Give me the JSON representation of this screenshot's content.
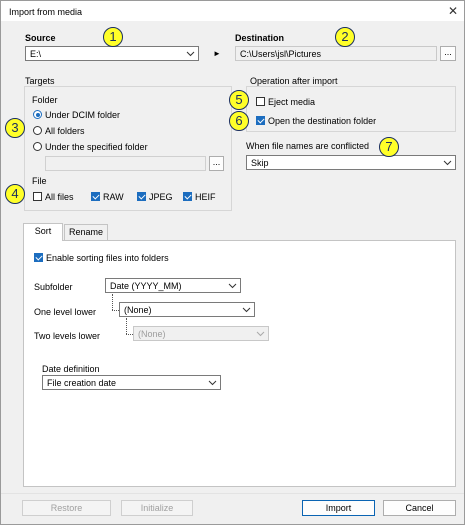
{
  "window": {
    "title": "Import from media",
    "close_symbol": "✕"
  },
  "source": {
    "label": "Source",
    "value": "E:\\"
  },
  "arrow_symbol": "►",
  "destination": {
    "label": "Destination",
    "value": "C:\\Users\\jsl\\Pictures",
    "browse_label": "..."
  },
  "targets": {
    "group_label": "Targets",
    "folder_label": "Folder",
    "options": [
      "Under DCIM folder",
      "All folders",
      "Under the specified folder"
    ],
    "selected_option": "Under DCIM folder",
    "specified_browse_label": "...",
    "file_label": "File",
    "file_types": [
      {
        "label": "All files",
        "checked": false
      },
      {
        "label": "RAW",
        "checked": true
      },
      {
        "label": "JPEG",
        "checked": true
      },
      {
        "label": "HEIF",
        "checked": true
      }
    ]
  },
  "operation": {
    "group_label": "Operation after import",
    "eject_label": "Eject media",
    "eject_checked": false,
    "open_dest_label": "Open the destination folder",
    "open_dest_checked": true
  },
  "conflict": {
    "label": "When file names are conflicted",
    "value": "Skip"
  },
  "tabs": {
    "sort": "Sort",
    "rename": "Rename",
    "selected": "Sort"
  },
  "sort": {
    "enable_label": "Enable sorting files into folders",
    "enable_checked": true,
    "subfolder_label": "Subfolder",
    "subfolder_value": "Date (YYYY_MM)",
    "one_level_label": "One level lower",
    "one_level_value": "(None)",
    "two_levels_label": "Two levels lower",
    "two_levels_value": "(None)",
    "date_def_label": "Date definition",
    "date_def_value": "File creation date"
  },
  "buttons": {
    "restore": "Restore",
    "initialize": "Initialize",
    "import": "Import",
    "cancel": "Cancel"
  },
  "callouts": [
    "1",
    "2",
    "3",
    "4",
    "5",
    "6",
    "7"
  ],
  "colors": {
    "accent": "#1c6dbf",
    "callout_fill": "#ffff29",
    "callout_border": "#1b2f5e"
  }
}
